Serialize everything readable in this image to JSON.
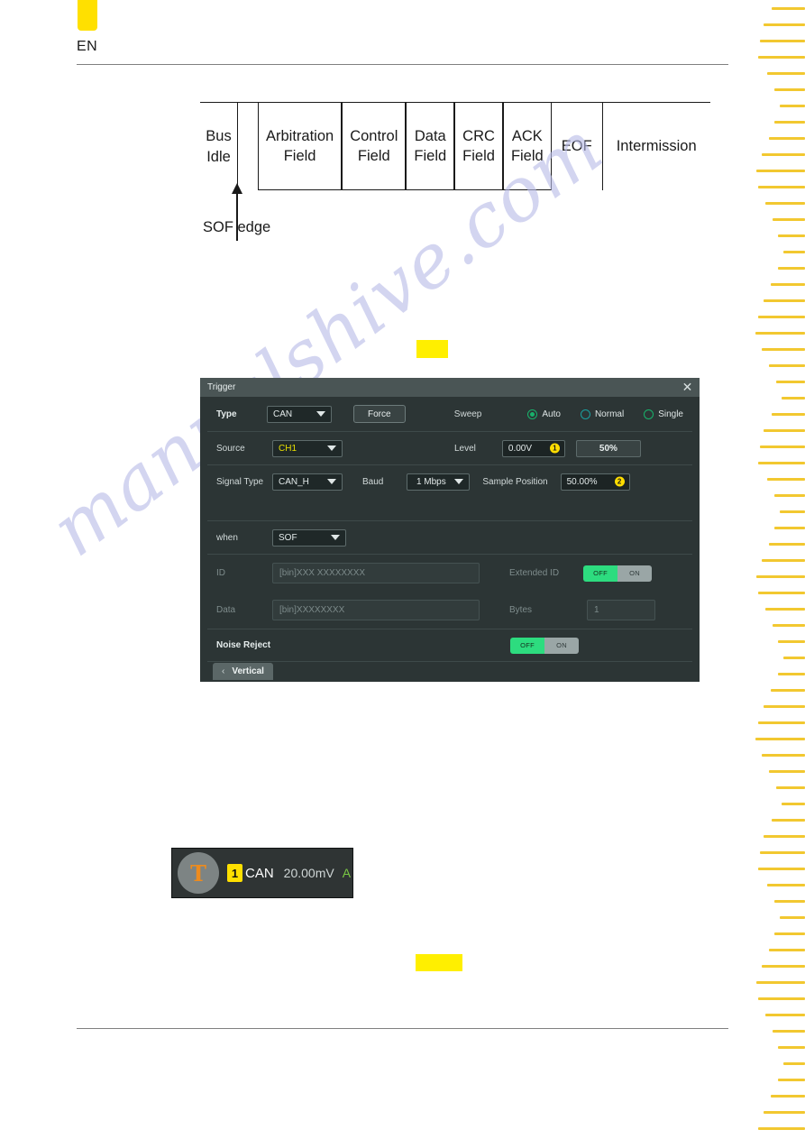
{
  "header": {
    "lang": "EN"
  },
  "frame_diagram": {
    "cells": [
      {
        "lines": [
          "Bus",
          "Idle"
        ]
      },
      {
        "lines": [
          "Arbitration",
          "Field"
        ]
      },
      {
        "lines": [
          "Control",
          "Field"
        ]
      },
      {
        "lines": [
          "Data",
          "Field"
        ]
      },
      {
        "lines": [
          "CRC",
          "Field"
        ]
      },
      {
        "lines": [
          "ACK",
          "Field"
        ]
      },
      {
        "lines": [
          "EOF"
        ]
      },
      {
        "lines": [
          "Intermission"
        ]
      }
    ],
    "annotation": "SOF edge"
  },
  "watermark": "manualshive.com",
  "trigger_dialog": {
    "title": "Trigger",
    "close_icon": "✕",
    "type": {
      "label": "Type",
      "value": "CAN"
    },
    "force_button": "Force",
    "sweep": {
      "label": "Sweep",
      "options": [
        "Auto",
        "Normal",
        "Single"
      ],
      "selected": "Auto"
    },
    "source": {
      "label": "Source",
      "value": "CH1"
    },
    "level": {
      "label": "Level",
      "value": "0.00V",
      "badge": "1",
      "percent": "50%"
    },
    "signal_type": {
      "label": "Signal Type",
      "value": "CAN_H"
    },
    "baud": {
      "label": "Baud",
      "value": "1 Mbps"
    },
    "sample_position": {
      "label": "Sample Position",
      "value": "50.00%",
      "badge": "2"
    },
    "when": {
      "label": "when",
      "value": "SOF"
    },
    "id": {
      "label": "ID",
      "placeholder": "[bin]XXX XXXXXXXX"
    },
    "extended_id": {
      "label": "Extended ID",
      "off": "OFF",
      "on": "ON",
      "state": "OFF"
    },
    "data": {
      "label": "Data",
      "placeholder": "[bin]XXXXXXXX"
    },
    "bytes": {
      "label": "Bytes",
      "value": "1"
    },
    "noise_reject": {
      "label": "Noise Reject",
      "off": "OFF",
      "on": "ON",
      "state": "OFF"
    },
    "vertical_tab": {
      "chevron": "‹",
      "label": "Vertical"
    }
  },
  "trigger_status": {
    "trigger_glyph": "T",
    "channel": "1",
    "protocol": "CAN",
    "scale": "20.00mV",
    "coupling": "A"
  },
  "colors": {
    "highlight": "#ffef00",
    "accent_yellow": "#ffe000",
    "toggle_on_green": "#2ddc7f",
    "radio_green": "#18b26b",
    "dialog_bg": "#2c3535",
    "titlebar_bg": "#4a5555",
    "ruler_dash": "#f2c830"
  }
}
